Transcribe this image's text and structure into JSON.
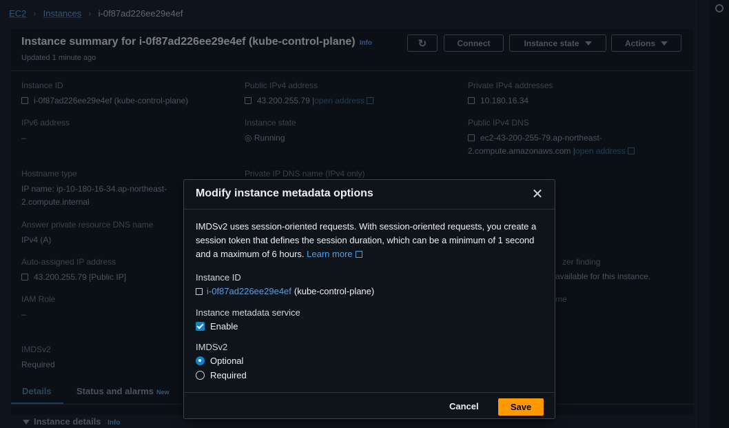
{
  "breadcrumb": {
    "root": "EC2",
    "section": "Instances",
    "current": "i-0f87ad226ee29e4ef"
  },
  "header": {
    "title": "Instance summary for i-0f87ad226ee29e4ef (kube-control-plane)",
    "info": "Info",
    "updated": "Updated 1 minute ago",
    "buttons": {
      "connect": "Connect",
      "instance_state": "Instance state",
      "actions": "Actions"
    }
  },
  "fields": {
    "instance_id": {
      "label": "Instance ID",
      "value": "i-0f87ad226ee29e4ef (kube-control-plane)"
    },
    "public_ipv4": {
      "label": "Public IPv4 address",
      "value": "43.200.255.79",
      "link": "open address"
    },
    "private_ipv4": {
      "label": "Private IPv4 addresses",
      "value": "10.180.16.34"
    },
    "ipv6": {
      "label": "IPv6 address",
      "value": "–"
    },
    "instance_state": {
      "label": "Instance state",
      "value": "Running"
    },
    "public_dns": {
      "label": "Public IPv4 DNS",
      "value_line1": "ec2-43-200-255-79.ap-northeast-",
      "value_line2": "2.compute.amazonaws.com",
      "link": "open address"
    },
    "hostname_type": {
      "label": "Hostname type",
      "value_line1": "IP name: ip-10-180-16-34.ap-northeast-",
      "value_line2": "2.compute.internal"
    },
    "private_dns": {
      "label": "Private IP DNS name (IPv4 only)"
    },
    "answer_dns": {
      "label": "Answer private resource DNS name",
      "value": "IPv4 (A)"
    },
    "auto_ip": {
      "label": "Auto-assigned IP address",
      "value": "43.200.255.79 [Public IP]"
    },
    "analyzer": {
      "label_fragment": "zer finding",
      "value_fragment": "available for this instance."
    },
    "iam_role": {
      "label": "IAM Role",
      "value": "–"
    },
    "name_fragment": "me",
    "imdsv2": {
      "label": "IMDSv2",
      "value": "Required"
    }
  },
  "tabs": {
    "details": "Details",
    "status": "Status and alarms",
    "new_badge": "New"
  },
  "instance_details": {
    "label": "Instance details",
    "info": "Info"
  },
  "modal": {
    "title": "Modify instance metadata options",
    "description": "IMDSv2 uses session-oriented requests. With session-oriented requests, you create a session token that defines the session duration, which can be a minimum of 1 second and a maximum of 6 hours.",
    "learn_more": "Learn more",
    "instance_id_label": "Instance ID",
    "instance_id_link": "i-0f87ad226ee29e4ef",
    "instance_name": "(kube-control-plane)",
    "metadata_label": "Instance metadata service",
    "enable_label": "Enable",
    "enable_checked": true,
    "imdsv2_label": "IMDSv2",
    "optional_label": "Optional",
    "required_label": "Required",
    "selected": "Optional",
    "cancel": "Cancel",
    "save": "Save"
  }
}
